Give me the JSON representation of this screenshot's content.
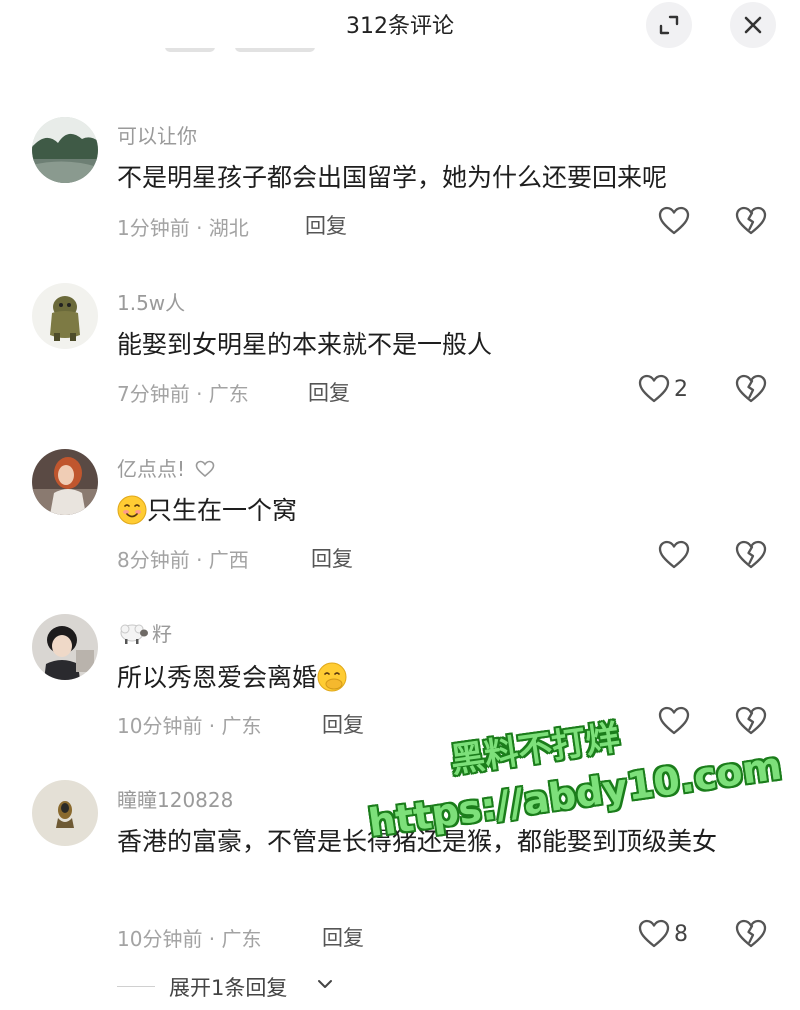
{
  "header": {
    "title": "312条评论",
    "expand_icon": "expand-icon",
    "close_icon": "close-icon"
  },
  "comments": [
    {
      "username": "可以让你",
      "text": "不是明星孩子都会出国留学，她为什么还要回来呢",
      "time": "1分钟前",
      "location": "湖北",
      "meta": "1分钟前 · 湖北",
      "reply_label": "回复",
      "likes": ""
    },
    {
      "username": "1.5w人",
      "text": "能娶到女明星的本来就不是一般人",
      "time": "7分钟前",
      "location": "广东",
      "meta": "7分钟前 · 广东",
      "reply_label": "回复",
      "likes": "2"
    },
    {
      "username": "亿点点!",
      "text": "只生在一个窝",
      "time": "8分钟前",
      "location": "广西",
      "meta": "8分钟前 · 广西",
      "reply_label": "回复",
      "likes": "",
      "text_prefix_icon": "smiling-face-emoji",
      "username_suffix_icon": "heart-outline-icon"
    },
    {
      "username": "籽",
      "text": "所以秀恩爱会离婚",
      "time": "10分钟前",
      "location": "广东",
      "meta": "10分钟前 · 广东",
      "reply_label": "回复",
      "likes": "",
      "username_prefix_icon": "sheep-emoji",
      "text_suffix_icon": "hand-over-mouth-emoji"
    },
    {
      "username": "瞳瞳120828",
      "text": "香港的富豪，不管是长得猪还是猴，都能娶到顶级美女",
      "time": "10分钟前",
      "location": "广东",
      "meta": "10分钟前 · 广东",
      "reply_label": "回复",
      "likes": "8"
    }
  ],
  "expand_replies": {
    "label": "展开1条回复",
    "icon": "chevron-down-icon"
  },
  "watermark": {
    "line1": "黑料不打烊",
    "line2": "https://abdy10.com",
    "color": "#7de07a"
  },
  "colors": {
    "text": "#1e1e1e",
    "muted": "#9a9a9a",
    "icon": "#555555"
  }
}
